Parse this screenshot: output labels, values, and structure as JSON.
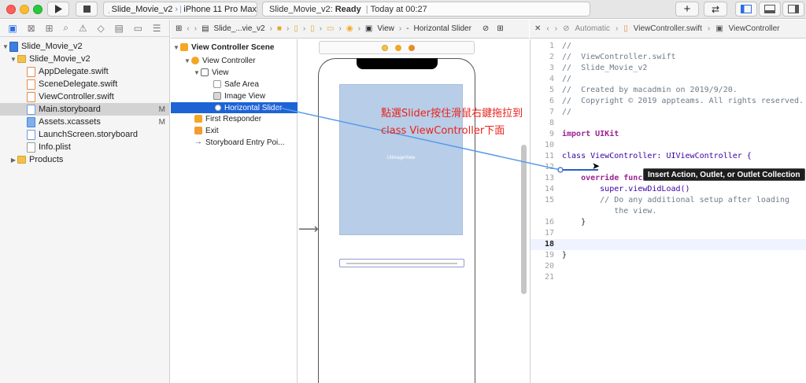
{
  "toolbar": {
    "scheme_project": "Slide_Movie_v2",
    "scheme_device": "iPhone 11 Pro Max",
    "activity_project": "Slide_Movie_v2:",
    "activity_status": "Ready",
    "activity_time": "Today at 00:27"
  },
  "navigator": {
    "items": [
      {
        "label": "Slide_Movie_v2",
        "badge": ""
      },
      {
        "label": "Slide_Movie_v2",
        "badge": ""
      },
      {
        "label": "AppDelegate.swift",
        "badge": ""
      },
      {
        "label": "SceneDelegate.swift",
        "badge": ""
      },
      {
        "label": "ViewController.swift",
        "badge": ""
      },
      {
        "label": "Main.storyboard",
        "badge": "M"
      },
      {
        "label": "Assets.xcassets",
        "badge": "M"
      },
      {
        "label": "LaunchScreen.storyboard",
        "badge": ""
      },
      {
        "label": "Info.plist",
        "badge": ""
      },
      {
        "label": "Products",
        "badge": ""
      }
    ]
  },
  "ib_jumpbar": {
    "project": "Slide_...vie_v2",
    "view": "View",
    "slider": "Horizontal Slider"
  },
  "outline": {
    "items": [
      {
        "label": "View Controller Scene"
      },
      {
        "label": "View Controller"
      },
      {
        "label": "View"
      },
      {
        "label": "Safe Area"
      },
      {
        "label": "Image View"
      },
      {
        "label": "Horizontal Slider"
      },
      {
        "label": "First Responder"
      },
      {
        "label": "Exit"
      },
      {
        "label": "Storyboard Entry Poi..."
      }
    ]
  },
  "canvas": {
    "image_view_label": "UIImageView"
  },
  "annotation": {
    "line1": "點選Slider按住滑鼠右鍵拖拉到",
    "line2": "class ViewController下面"
  },
  "editor_jumpbar": {
    "mode": "Automatic",
    "file": "ViewController.swift",
    "class": "ViewController"
  },
  "code": {
    "lines": [
      {
        "num": "1",
        "text": "//"
      },
      {
        "num": "2",
        "text": "//  ViewController.swift"
      },
      {
        "num": "3",
        "text": "//  Slide_Movie_v2"
      },
      {
        "num": "4",
        "text": "//"
      },
      {
        "num": "5",
        "text": "//  Created by macadmin on 2019/9/20."
      },
      {
        "num": "6",
        "text": "//  Copyright © 2019 appteams. All rights reserved."
      },
      {
        "num": "7",
        "text": "//"
      },
      {
        "num": "8",
        "text": ""
      },
      {
        "num": "9",
        "text": "import UIKit"
      },
      {
        "num": "10",
        "text": ""
      },
      {
        "num": "11",
        "text": "class ViewController: UIViewController {"
      },
      {
        "num": "12",
        "text": ""
      },
      {
        "num": "13",
        "text": "    override func"
      },
      {
        "num": "14",
        "text": "        super.viewDidLoad()"
      },
      {
        "num": "15",
        "text": "        // Do any additional setup after loading"
      },
      {
        "num": "",
        "text": "           the view."
      },
      {
        "num": "16",
        "text": "    }"
      },
      {
        "num": "17",
        "text": ""
      },
      {
        "num": "18",
        "text": ""
      },
      {
        "num": "19",
        "text": "}"
      },
      {
        "num": "20",
        "text": ""
      },
      {
        "num": "21",
        "text": ""
      }
    ]
  },
  "tooltip": "Insert Action, Outlet, or Outlet Collection"
}
